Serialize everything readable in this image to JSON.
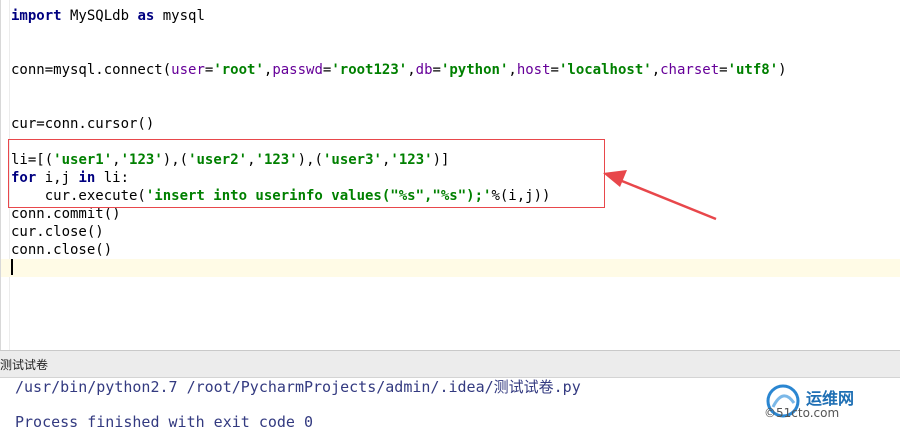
{
  "editor": {
    "lines": [
      {
        "id": "l1",
        "parts": [
          {
            "t": "import",
            "c": "kw"
          },
          {
            "t": " MySQLdb ",
            "c": ""
          },
          {
            "t": "as",
            "c": "kw"
          },
          {
            "t": " mysql",
            "c": ""
          }
        ]
      },
      {
        "id": "l2",
        "parts": [
          {
            "t": "conn=mysql.connect(",
            "c": ""
          },
          {
            "t": "user",
            "c": "param"
          },
          {
            "t": "=",
            "c": ""
          },
          {
            "t": "'root'",
            "c": "str"
          },
          {
            "t": ",",
            "c": ""
          },
          {
            "t": "passwd",
            "c": "param"
          },
          {
            "t": "=",
            "c": ""
          },
          {
            "t": "'root123'",
            "c": "str"
          },
          {
            "t": ",",
            "c": ""
          },
          {
            "t": "db",
            "c": "param"
          },
          {
            "t": "=",
            "c": ""
          },
          {
            "t": "'python'",
            "c": "str"
          },
          {
            "t": ",",
            "c": ""
          },
          {
            "t": "host",
            "c": "param"
          },
          {
            "t": "=",
            "c": ""
          },
          {
            "t": "'localhost'",
            "c": "str"
          },
          {
            "t": ",",
            "c": ""
          },
          {
            "t": "charset",
            "c": "param"
          },
          {
            "t": "=",
            "c": ""
          },
          {
            "t": "'utf8'",
            "c": "str"
          },
          {
            "t": ")",
            "c": ""
          }
        ]
      },
      {
        "id": "l3",
        "parts": [
          {
            "t": "cur=conn.cursor()",
            "c": ""
          }
        ]
      },
      {
        "id": "l4",
        "parts": [
          {
            "t": "li=[(",
            "c": ""
          },
          {
            "t": "'user1'",
            "c": "str"
          },
          {
            "t": ",",
            "c": ""
          },
          {
            "t": "'123'",
            "c": "str"
          },
          {
            "t": "),(",
            "c": ""
          },
          {
            "t": "'user2'",
            "c": "str"
          },
          {
            "t": ",",
            "c": ""
          },
          {
            "t": "'123'",
            "c": "str"
          },
          {
            "t": "),(",
            "c": ""
          },
          {
            "t": "'user3'",
            "c": "str"
          },
          {
            "t": ",",
            "c": ""
          },
          {
            "t": "'123'",
            "c": "str"
          },
          {
            "t": ")]",
            "c": ""
          }
        ]
      },
      {
        "id": "l5",
        "parts": [
          {
            "t": "for",
            "c": "kw"
          },
          {
            "t": " i,j ",
            "c": ""
          },
          {
            "t": "in",
            "c": "kw"
          },
          {
            "t": " li:",
            "c": ""
          }
        ]
      },
      {
        "id": "l6",
        "parts": [
          {
            "t": "    cur.execute(",
            "c": ""
          },
          {
            "t": "'insert into userinfo values(\"%s\",\"%s\");'",
            "c": "str"
          },
          {
            "t": "%(i,j))",
            "c": ""
          }
        ]
      },
      {
        "id": "l7",
        "parts": [
          {
            "t": "conn.commit()",
            "c": ""
          }
        ]
      },
      {
        "id": "l8",
        "parts": [
          {
            "t": "cur.close()",
            "c": ""
          }
        ]
      },
      {
        "id": "l9",
        "parts": [
          {
            "t": "conn.close()",
            "c": ""
          }
        ]
      }
    ]
  },
  "run_panel": {
    "title": "测试试卷",
    "command": "/usr/bin/python2.7 /root/PycharmProjects/admin/.idea/测试试卷.py",
    "exit_message": "Process finished with exit code 0"
  },
  "watermark": {
    "name": "运维网",
    "sub": "©51cto.com"
  },
  "colors": {
    "highlight_box": "#e8474b",
    "keyword": "#000080",
    "string": "#008000",
    "param": "#660099"
  }
}
